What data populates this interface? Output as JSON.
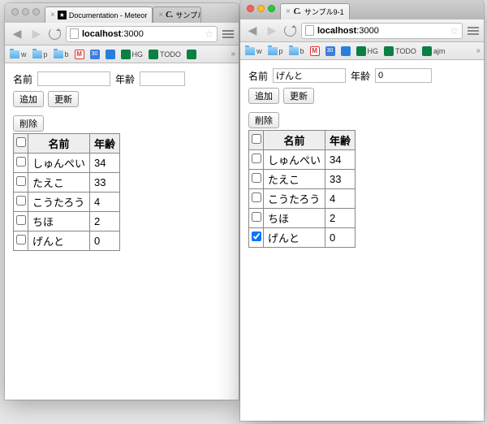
{
  "window1": {
    "tabs": [
      {
        "favicon": "meteor",
        "title": "Documentation - Meteor"
      },
      {
        "favicon": "c",
        "title": "サンプル"
      }
    ],
    "address": "localhost:3000",
    "bookmarks": [
      {
        "type": "folder",
        "label": "w"
      },
      {
        "type": "folder",
        "label": "p"
      },
      {
        "type": "folder",
        "label": "b"
      },
      {
        "type": "gmail",
        "label": ""
      },
      {
        "type": "cal",
        "label": "30"
      },
      {
        "type": "blue",
        "label": ""
      },
      {
        "type": "green",
        "label": "HG"
      },
      {
        "type": "green",
        "label": "TODO"
      },
      {
        "type": "green",
        "label": ""
      }
    ],
    "form": {
      "name_label": "名前",
      "name_value": "",
      "age_label": "年齢",
      "age_value": ""
    },
    "buttons": {
      "add": "追加",
      "update": "更新",
      "delete": "削除"
    },
    "table": {
      "headers": {
        "name": "名前",
        "age": "年齢"
      },
      "rows": [
        {
          "checked": false,
          "name": "しゅんぺい",
          "age": "34"
        },
        {
          "checked": false,
          "name": "たえこ",
          "age": "33"
        },
        {
          "checked": false,
          "name": "こうたろう",
          "age": "4"
        },
        {
          "checked": false,
          "name": "ちほ",
          "age": "2"
        },
        {
          "checked": false,
          "name": "げんと",
          "age": "0"
        }
      ]
    }
  },
  "window2": {
    "tabs": [
      {
        "favicon": "c",
        "title": "サンプル9-1"
      }
    ],
    "address": "localhost:3000",
    "bookmarks": [
      {
        "type": "folder",
        "label": "w"
      },
      {
        "type": "folder",
        "label": "p"
      },
      {
        "type": "folder",
        "label": "b"
      },
      {
        "type": "gmail",
        "label": ""
      },
      {
        "type": "cal",
        "label": "30"
      },
      {
        "type": "blue",
        "label": ""
      },
      {
        "type": "green",
        "label": "HG"
      },
      {
        "type": "green",
        "label": "TODO"
      },
      {
        "type": "green",
        "label": "ajm"
      }
    ],
    "form": {
      "name_label": "名前",
      "name_value": "げんと",
      "age_label": "年齢",
      "age_value": "0"
    },
    "buttons": {
      "add": "追加",
      "update": "更新",
      "delete": "削除"
    },
    "table": {
      "headers": {
        "name": "名前",
        "age": "年齢"
      },
      "rows": [
        {
          "checked": false,
          "name": "しゅんぺい",
          "age": "34"
        },
        {
          "checked": false,
          "name": "たえこ",
          "age": "33"
        },
        {
          "checked": false,
          "name": "こうたろう",
          "age": "4"
        },
        {
          "checked": false,
          "name": "ちほ",
          "age": "2"
        },
        {
          "checked": true,
          "name": "げんと",
          "age": "0"
        }
      ]
    }
  }
}
